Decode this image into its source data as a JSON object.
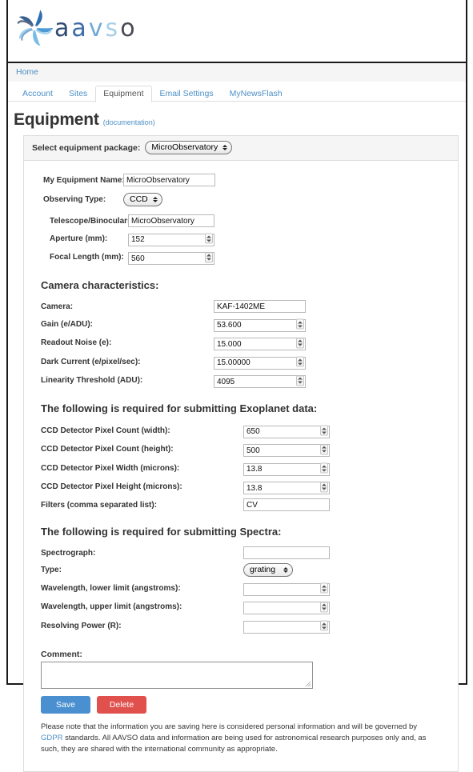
{
  "brand": {
    "logo_icon": "aavso-swirl-logo-icon",
    "wordmark": [
      "a",
      "a",
      "v",
      "s",
      "o"
    ],
    "colors": {
      "accent_blue": "#4d8fc4",
      "save_blue": "#4a8fd0",
      "delete_red": "#e0514d"
    }
  },
  "breadcrumb": {
    "home": "Home"
  },
  "tabs": [
    {
      "label": "Account",
      "active": false
    },
    {
      "label": "Sites",
      "active": false
    },
    {
      "label": "Equipment",
      "active": true
    },
    {
      "label": "Email Settings",
      "active": false
    },
    {
      "label": "MyNewsFlash",
      "active": false
    }
  ],
  "page": {
    "title": "Equipment",
    "documentation_link": "(documentation)"
  },
  "panel": {
    "header_label": "Select equipment package:",
    "package_value": "MicroObservatory"
  },
  "general": {
    "equipment_name_label": "My Equipment Name:",
    "equipment_name_value": "MicroObservatory",
    "observing_type_label": "Observing Type:",
    "observing_type_value": "CCD"
  },
  "telescope": {
    "rows": [
      {
        "label": "Telescope/Binoculars:",
        "value": "MicroObservatory",
        "spinner": false
      },
      {
        "label": "Aperture (mm):",
        "value": "152",
        "spinner": true
      },
      {
        "label": "Focal Length (mm):",
        "value": "560",
        "spinner": true
      }
    ]
  },
  "camera": {
    "heading": "Camera characteristics:",
    "rows": [
      {
        "label": "Camera:",
        "value": "KAF-1402ME",
        "spinner": false
      },
      {
        "label": "Gain (e/ADU):",
        "value": "53.600",
        "spinner": true
      },
      {
        "label": "Readout Noise (e):",
        "value": "15.000",
        "spinner": true
      },
      {
        "label": "Dark Current (e/pixel/sec):",
        "value": "15.00000",
        "spinner": true
      },
      {
        "label": "Linearity Threshold (ADU):",
        "value": "4095",
        "spinner": true
      }
    ]
  },
  "exoplanet": {
    "heading": "The following is required for submitting Exoplanet data:",
    "rows": [
      {
        "label": "CCD Detector Pixel Count (width):",
        "value": "650",
        "spinner": true
      },
      {
        "label": "CCD Detector Pixel Count (height):",
        "value": "500",
        "spinner": true
      },
      {
        "label": "CCD Detector Pixel Width (microns):",
        "value": "13.8",
        "spinner": true
      },
      {
        "label": "CCD Detector Pixel Height (microns):",
        "value": "13.8",
        "spinner": true
      },
      {
        "label": "Filters (comma separated list):",
        "value": "CV",
        "spinner": false
      }
    ]
  },
  "spectra": {
    "heading": "The following is required for submitting Spectra:",
    "spectrograph_label": "Spectrograph:",
    "spectrograph_value": "",
    "type_label": "Type:",
    "type_value": "grating",
    "rows": [
      {
        "label": "Wavelength, lower limit (angstroms):",
        "value": "",
        "spinner": true
      },
      {
        "label": "Wavelength, upper limit (angstroms):",
        "value": "",
        "spinner": true
      },
      {
        "label": "Resolving Power (R):",
        "value": "",
        "spinner": true
      }
    ]
  },
  "comment": {
    "label": "Comment:",
    "value": ""
  },
  "actions": {
    "save_label": "Save",
    "delete_label": "Delete"
  },
  "footer": {
    "text_before": "Please note that the information you are saving here is considered personal information and will be governed by ",
    "link": "GDPR",
    "text_after": " standards. All AAVSO data and information are being used for astronomical research purposes only and, as such, they are shared with the international community as appropriate."
  }
}
